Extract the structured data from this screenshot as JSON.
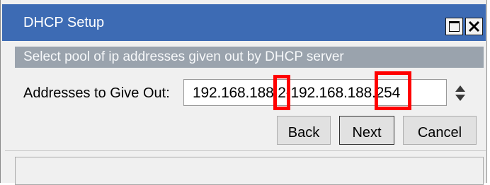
{
  "window": {
    "title": "DHCP Setup",
    "title_bar_color": "#3d6bb4",
    "controls": {
      "maximize_icon": "maximize-icon",
      "close_icon": "close-icon"
    }
  },
  "banner": {
    "text": "Select pool of ip addresses given out by DHCP server"
  },
  "form": {
    "addresses_label": "Addresses to Give Out:",
    "addresses_value": "192.168.188.2-192.168.188.254",
    "spinner_icon": "spinner-arrows-icon"
  },
  "buttons": {
    "back": "Back",
    "next": "Next",
    "cancel": "Cancel"
  },
  "highlights": {
    "color": "#ff0000"
  }
}
